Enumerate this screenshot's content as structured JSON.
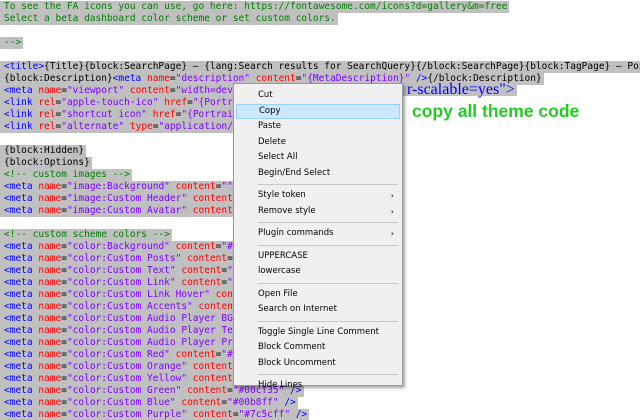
{
  "editor": {
    "lines": [
      [
        {
          "t": "To see the FA icons you can use, go here: https://fontawesome.com/icons?d=gallery&m=free",
          "c": "cmt"
        }
      ],
      [
        {
          "t": "Select a beta dashboard color scheme or set custom colors.",
          "c": "cmt"
        }
      ],
      [
        {
          "t": "",
          "c": "bk"
        }
      ],
      [
        {
          "t": "-->",
          "c": "cmt"
        }
      ],
      [
        {
          "t": "",
          "c": "bk"
        }
      ],
      [
        {
          "t": "<title>",
          "c": "tag"
        },
        {
          "t": "{Title}{block:SearchPage} — {lang:Search results for SearchQuery}{/block:SearchPage}{block:TagPage} — Posts",
          "c": "bk"
        }
      ],
      [
        {
          "t": "{block:Description}",
          "c": "bk"
        },
        {
          "t": "<meta ",
          "c": "tag"
        },
        {
          "t": "name",
          "c": "attr"
        },
        {
          "t": "=",
          "c": "op"
        },
        {
          "t": "\"description\" ",
          "c": "val"
        },
        {
          "t": "content",
          "c": "attr"
        },
        {
          "t": "=",
          "c": "op"
        },
        {
          "t": "\"{MetaDescription}\" ",
          "c": "val"
        },
        {
          "t": "/>",
          "c": "tag"
        },
        {
          "t": "{/block:Description}",
          "c": "bk"
        }
      ],
      [
        {
          "t": "<meta ",
          "c": "tag"
        },
        {
          "t": "name",
          "c": "attr"
        },
        {
          "t": "=",
          "c": "op"
        },
        {
          "t": "\"viewport\" ",
          "c": "val"
        },
        {
          "t": "content",
          "c": "attr"
        },
        {
          "t": "=",
          "c": "op"
        },
        {
          "t": "\"width=dev",
          "c": "val"
        }
      ],
      [
        {
          "t": "<link ",
          "c": "tag"
        },
        {
          "t": "rel",
          "c": "attr"
        },
        {
          "t": "=",
          "c": "op"
        },
        {
          "t": "\"apple-touch-ico\" ",
          "c": "val"
        },
        {
          "t": "href",
          "c": "attr"
        },
        {
          "t": "=",
          "c": "op"
        },
        {
          "t": "\"{Portra",
          "c": "val"
        }
      ],
      [
        {
          "t": "<link ",
          "c": "tag"
        },
        {
          "t": "rel",
          "c": "attr"
        },
        {
          "t": "=",
          "c": "op"
        },
        {
          "t": "\"shortcut icon\" ",
          "c": "val"
        },
        {
          "t": "href",
          "c": "attr"
        },
        {
          "t": "=",
          "c": "op"
        },
        {
          "t": "\"{Portrait",
          "c": "val"
        }
      ],
      [
        {
          "t": "<link ",
          "c": "tag"
        },
        {
          "t": "rel",
          "c": "attr"
        },
        {
          "t": "=",
          "c": "op"
        },
        {
          "t": "\"alternate\" ",
          "c": "val"
        },
        {
          "t": "type",
          "c": "attr"
        },
        {
          "t": "=",
          "c": "op"
        },
        {
          "t": "\"application/r",
          "c": "val"
        }
      ],
      [
        {
          "t": "",
          "c": "bk"
        }
      ],
      [
        {
          "t": "{block:Hidden}",
          "c": "bk"
        }
      ],
      [
        {
          "t": "{block:Options}",
          "c": "bk"
        }
      ],
      [
        {
          "t": "<!-- custom images -->",
          "c": "cmt"
        }
      ],
      [
        {
          "t": "<meta ",
          "c": "tag"
        },
        {
          "t": "name",
          "c": "attr"
        },
        {
          "t": "=",
          "c": "op"
        },
        {
          "t": "\"image:Background\" ",
          "c": "val"
        },
        {
          "t": "content",
          "c": "attr"
        },
        {
          "t": "=",
          "c": "op"
        },
        {
          "t": "\"\"",
          "c": "val"
        }
      ],
      [
        {
          "t": "<meta ",
          "c": "tag"
        },
        {
          "t": "name",
          "c": "attr"
        },
        {
          "t": "=",
          "c": "op"
        },
        {
          "t": "\"image:Custom Header\" ",
          "c": "val"
        },
        {
          "t": "content",
          "c": "attr"
        },
        {
          "t": "=",
          "c": "op"
        }
      ],
      [
        {
          "t": "<meta ",
          "c": "tag"
        },
        {
          "t": "name",
          "c": "attr"
        },
        {
          "t": "=",
          "c": "op"
        },
        {
          "t": "\"image:Custom Avatar\" ",
          "c": "val"
        },
        {
          "t": "content",
          "c": "attr"
        },
        {
          "t": "=",
          "c": "op"
        }
      ],
      [
        {
          "t": "",
          "c": "bk"
        }
      ],
      [
        {
          "t": "<!-- custom scheme colors -->",
          "c": "cmt"
        }
      ],
      [
        {
          "t": "<meta ",
          "c": "tag"
        },
        {
          "t": "name",
          "c": "attr"
        },
        {
          "t": "=",
          "c": "op"
        },
        {
          "t": "\"color:Background\" ",
          "c": "val"
        },
        {
          "t": "content",
          "c": "attr"
        },
        {
          "t": "=",
          "c": "op"
        },
        {
          "t": "\"#1",
          "c": "val"
        }
      ],
      [
        {
          "t": "<meta ",
          "c": "tag"
        },
        {
          "t": "name",
          "c": "attr"
        },
        {
          "t": "=",
          "c": "op"
        },
        {
          "t": "\"color:Custom Posts\" ",
          "c": "val"
        },
        {
          "t": "content",
          "c": "attr"
        },
        {
          "t": "=",
          "c": "op"
        },
        {
          "t": "\"",
          "c": "val"
        }
      ],
      [
        {
          "t": "<meta ",
          "c": "tag"
        },
        {
          "t": "name",
          "c": "attr"
        },
        {
          "t": "=",
          "c": "op"
        },
        {
          "t": "\"color:Custom Text\" ",
          "c": "val"
        },
        {
          "t": "content",
          "c": "attr"
        },
        {
          "t": "=",
          "c": "op"
        },
        {
          "t": "\"#",
          "c": "val"
        }
      ],
      [
        {
          "t": "<meta ",
          "c": "tag"
        },
        {
          "t": "name",
          "c": "attr"
        },
        {
          "t": "=",
          "c": "op"
        },
        {
          "t": "\"color:Custom Link\" ",
          "c": "val"
        },
        {
          "t": "content",
          "c": "attr"
        },
        {
          "t": "=",
          "c": "op"
        },
        {
          "t": "\"#",
          "c": "val"
        }
      ],
      [
        {
          "t": "<meta ",
          "c": "tag"
        },
        {
          "t": "name",
          "c": "attr"
        },
        {
          "t": "=",
          "c": "op"
        },
        {
          "t": "\"color:Custom Link Hover\" ",
          "c": "val"
        },
        {
          "t": "cont",
          "c": "attr"
        }
      ],
      [
        {
          "t": "<meta ",
          "c": "tag"
        },
        {
          "t": "name",
          "c": "attr"
        },
        {
          "t": "=",
          "c": "op"
        },
        {
          "t": "\"color:Custom Accents\" ",
          "c": "val"
        },
        {
          "t": "content",
          "c": "attr"
        }
      ],
      [
        {
          "t": "<meta ",
          "c": "tag"
        },
        {
          "t": "name",
          "c": "attr"
        },
        {
          "t": "=",
          "c": "op"
        },
        {
          "t": "\"color:Custom Audio Player BG\"",
          "c": "val"
        }
      ],
      [
        {
          "t": "<meta ",
          "c": "tag"
        },
        {
          "t": "name",
          "c": "attr"
        },
        {
          "t": "=",
          "c": "op"
        },
        {
          "t": "\"color:Custom Audio Player Tex",
          "c": "val"
        }
      ],
      [
        {
          "t": "<meta ",
          "c": "tag"
        },
        {
          "t": "name",
          "c": "attr"
        },
        {
          "t": "=",
          "c": "op"
        },
        {
          "t": "\"color:Custom Audio Player Pro",
          "c": "val"
        }
      ],
      [
        {
          "t": "<meta ",
          "c": "tag"
        },
        {
          "t": "name",
          "c": "attr"
        },
        {
          "t": "=",
          "c": "op"
        },
        {
          "t": "\"color:Custom Red\" ",
          "c": "val"
        },
        {
          "t": "content",
          "c": "attr"
        },
        {
          "t": "=",
          "c": "op"
        },
        {
          "t": "\"#1",
          "c": "val"
        }
      ],
      [
        {
          "t": "<meta ",
          "c": "tag"
        },
        {
          "t": "name",
          "c": "attr"
        },
        {
          "t": "=",
          "c": "op"
        },
        {
          "t": "\"color:Custom Orange\" ",
          "c": "val"
        },
        {
          "t": "content",
          "c": "attr"
        }
      ],
      [
        {
          "t": "<meta ",
          "c": "tag"
        },
        {
          "t": "name",
          "c": "attr"
        },
        {
          "t": "=",
          "c": "op"
        },
        {
          "t": "\"color:Custom Yellow\" ",
          "c": "val"
        },
        {
          "t": "content",
          "c": "attr"
        }
      ],
      [
        {
          "t": "<meta ",
          "c": "tag"
        },
        {
          "t": "name",
          "c": "attr"
        },
        {
          "t": "=",
          "c": "op"
        },
        {
          "t": "\"color:Custom Green\" ",
          "c": "val"
        },
        {
          "t": "content",
          "c": "attr"
        },
        {
          "t": "=",
          "c": "op"
        },
        {
          "t": "\"#00cf35\" ",
          "c": "val"
        },
        {
          "t": "/>",
          "c": "tag"
        }
      ],
      [
        {
          "t": "<meta ",
          "c": "tag"
        },
        {
          "t": "name",
          "c": "attr"
        },
        {
          "t": "=",
          "c": "op"
        },
        {
          "t": "\"color:Custom Blue\" ",
          "c": "val"
        },
        {
          "t": "content",
          "c": "attr"
        },
        {
          "t": "=",
          "c": "op"
        },
        {
          "t": "\"#00b8ff\" ",
          "c": "val"
        },
        {
          "t": "/>",
          "c": "tag"
        }
      ],
      [
        {
          "t": "<meta ",
          "c": "tag"
        },
        {
          "t": "name",
          "c": "attr"
        },
        {
          "t": "=",
          "c": "op"
        },
        {
          "t": "\"color:Custom Purple\" ",
          "c": "val"
        },
        {
          "t": "content",
          "c": "attr"
        },
        {
          "t": "=",
          "c": "op"
        },
        {
          "t": "\"#7c5cff\" ",
          "c": "val"
        },
        {
          "t": "/>",
          "c": "tag"
        }
      ]
    ],
    "line7_tail": "r-scalable=yes\">"
  },
  "context_menu": {
    "items": [
      {
        "label": "Cut"
      },
      {
        "label": "Copy",
        "highlighted": true
      },
      {
        "label": "Paste"
      },
      {
        "label": "Delete"
      },
      {
        "label": "Select All"
      },
      {
        "label": "Begin/End Select"
      },
      {
        "separator": true
      },
      {
        "label": "Style token",
        "submenu": true
      },
      {
        "label": "Remove style",
        "submenu": true
      },
      {
        "separator": true
      },
      {
        "label": "Plugin commands",
        "submenu": true
      },
      {
        "separator": true
      },
      {
        "label": "UPPERCASE"
      },
      {
        "label": "lowercase"
      },
      {
        "separator": true
      },
      {
        "label": "Open File"
      },
      {
        "label": "Search on Internet"
      },
      {
        "separator": true
      },
      {
        "label": "Toggle Single Line Comment"
      },
      {
        "label": "Block Comment"
      },
      {
        "label": "Block Uncomment"
      },
      {
        "separator": true
      },
      {
        "label": "Hide Lines"
      }
    ]
  },
  "annotation": {
    "text": "copy all theme code",
    "color": "#22cc22"
  },
  "colors": {
    "selection": "#c0c0c0",
    "menu_highlight": "#cce8ff"
  }
}
